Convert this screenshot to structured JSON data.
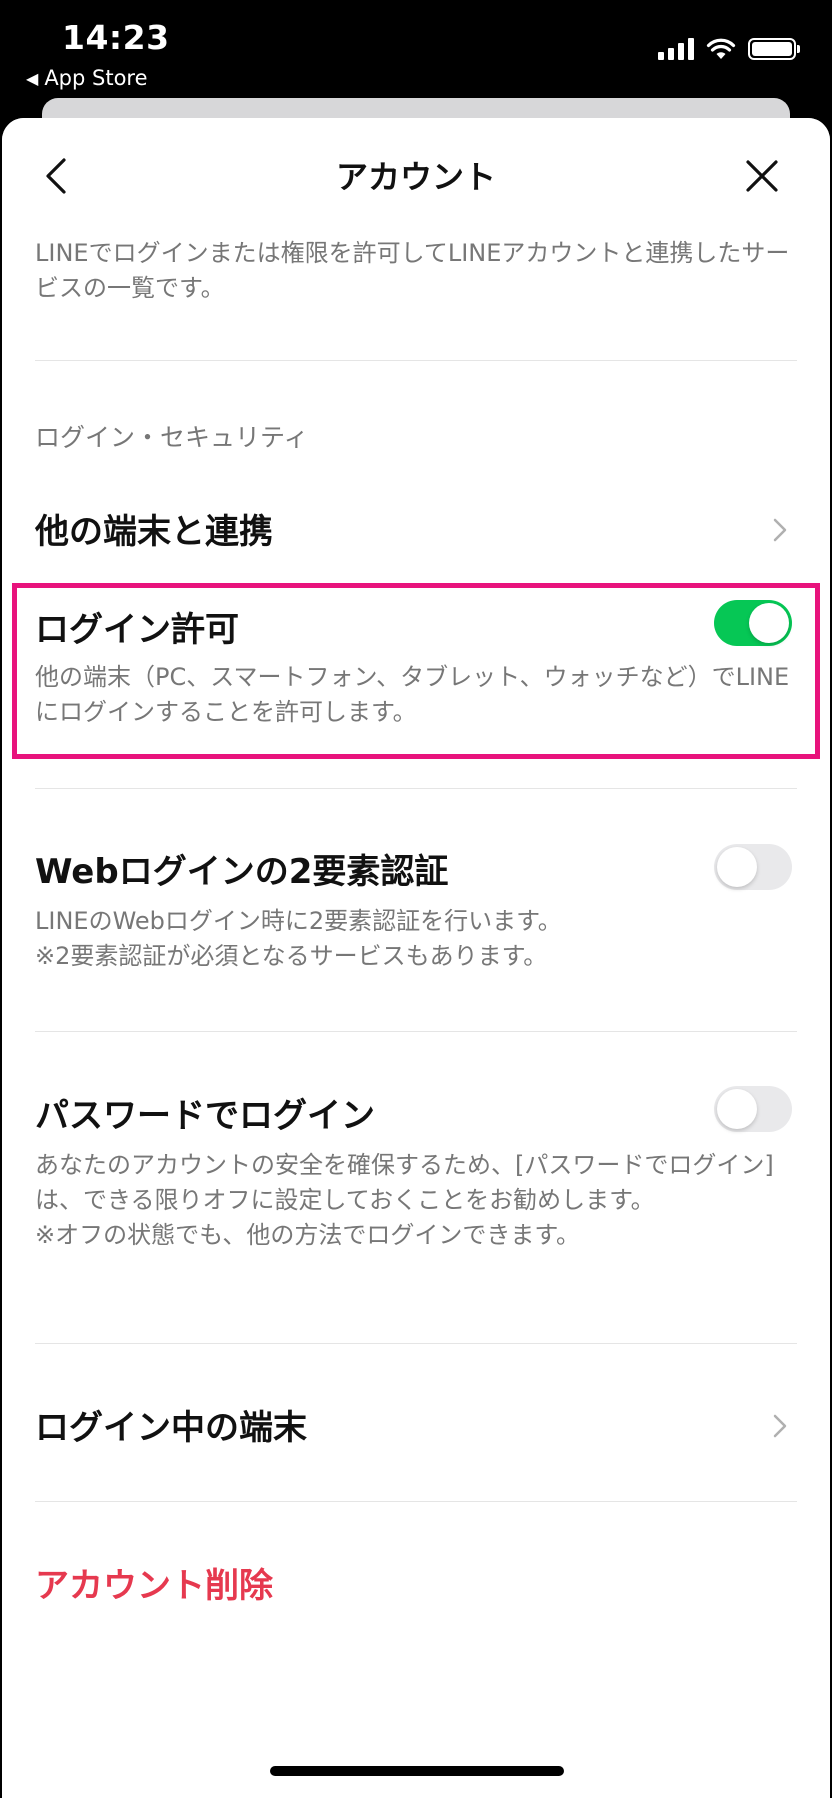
{
  "status_bar": {
    "time": "14:23",
    "back_app": "App Store",
    "back_glyph": "◀"
  },
  "nav": {
    "title": "アカウント",
    "back_icon": "chevron-left-icon",
    "close_icon": "close-icon"
  },
  "intro_text": "LINEでログインまたは権限を許可してLINEアカウントと連携したサービスの一覧です。",
  "section_header": "ログイン・セキュリティ",
  "rows": {
    "link_devices": {
      "title": "他の端末と連携"
    },
    "allow_login": {
      "title": "ログイン許可",
      "description": "他の端末（PC、スマートフォン、タブレット、ウォッチなど）でLINEにログインすることを許可します。",
      "enabled": true
    },
    "web_2fa": {
      "title": "Webログインの2要素認証",
      "description_1": "LINEのWebログイン時に2要素認証を行います。",
      "description_2": "※2要素認証が必須となるサービスもあります。",
      "enabled": false
    },
    "password_login": {
      "title": "パスワードでログイン",
      "description_1": "あなたのアカウントの安全を確保するため、[パスワードでログイン]は、できる限りオフに設定しておくことをお勧めします。",
      "description_2": "※オフの状態でも、他の方法でログインできます。",
      "enabled": false
    },
    "logged_in_devices": {
      "title": "ログイン中の端末"
    }
  },
  "delete_account": "アカウント削除",
  "colors": {
    "toggle_on": "#06c755",
    "highlight_border": "#e8137c",
    "danger_text": "#e6394f"
  }
}
